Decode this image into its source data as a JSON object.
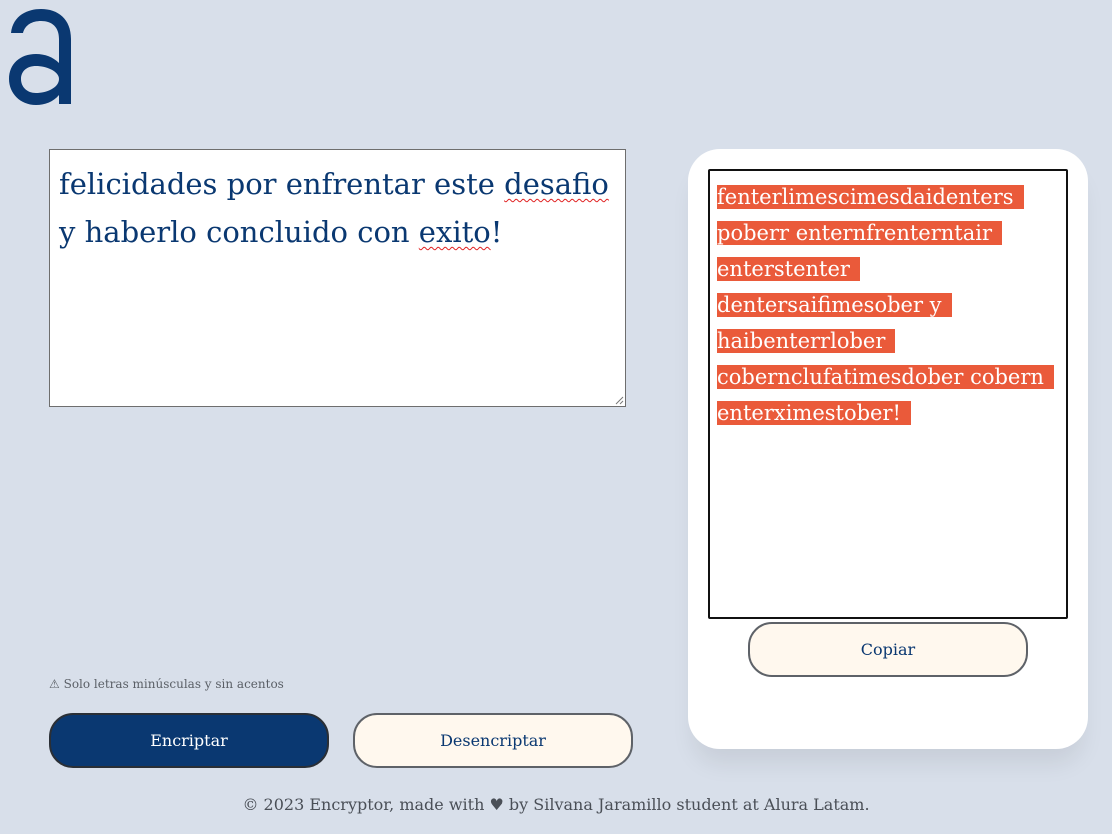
{
  "brand": {
    "logo_icon": "alura-a-logo-icon",
    "color": "#0a3871"
  },
  "input": {
    "text_parts": {
      "p1": "felicidades por enfrentar este ",
      "p2": "desafio",
      "p3": " y haberlo concluido con ",
      "p4": "exito",
      "p5": "!"
    }
  },
  "warning": {
    "icon": "⚠",
    "icon_name": "warning-icon",
    "text": "Solo letras minúsculas y sin acentos"
  },
  "buttons": {
    "encrypt_label": "Encriptar",
    "decrypt_label": "Desencriptar",
    "copy_label": "Copiar"
  },
  "output": {
    "text": "fenterlimescimesdaidenters poberr enternfrenterntair enterstenter dentersaifimesober y haibenterrlober cobernclufatimesdober cobern enterximestober!",
    "selection_color": "#ea5a3a"
  },
  "footer": {
    "text": "© 2023 Encryptor, made with ♥ by Silvana Jaramillo student at Alura Latam."
  },
  "colors": {
    "background": "#d8dfea",
    "primary": "#0a3871",
    "secondary_bg": "#fff8ee"
  }
}
